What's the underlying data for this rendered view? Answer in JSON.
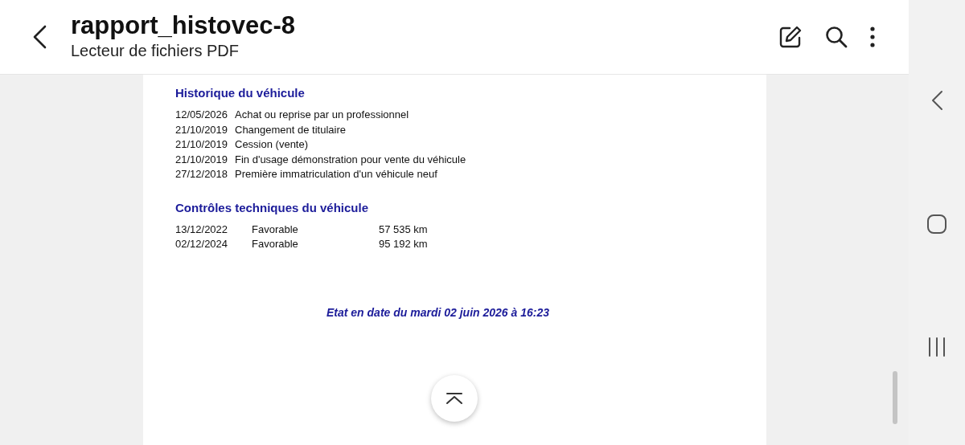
{
  "header": {
    "title": "rapport_histovec-8",
    "subtitle": "Lecteur de fichiers PDF"
  },
  "document": {
    "sections": [
      {
        "heading": "Historique du véhicule",
        "kind": "events",
        "rows": [
          [
            "12/05/2026",
            "Achat ou reprise par un professionnel"
          ],
          [
            "21/10/2019",
            "Changement de titulaire"
          ],
          [
            "21/10/2019",
            "Cession (vente)"
          ],
          [
            "21/10/2019",
            "Fin d'usage démonstration pour vente du véhicule"
          ],
          [
            "27/12/2018",
            "Première immatriculation d'un véhicule neuf"
          ]
        ]
      },
      {
        "heading": "Contrôles techniques du véhicule",
        "kind": "inspections",
        "rows": [
          [
            "13/12/2022",
            "Favorable",
            "57 535 km"
          ],
          [
            "02/12/2024",
            "Favorable",
            "95 192 km"
          ]
        ]
      }
    ],
    "footer": "Etat en date du mardi 02 juin 2026 à 16:23"
  }
}
